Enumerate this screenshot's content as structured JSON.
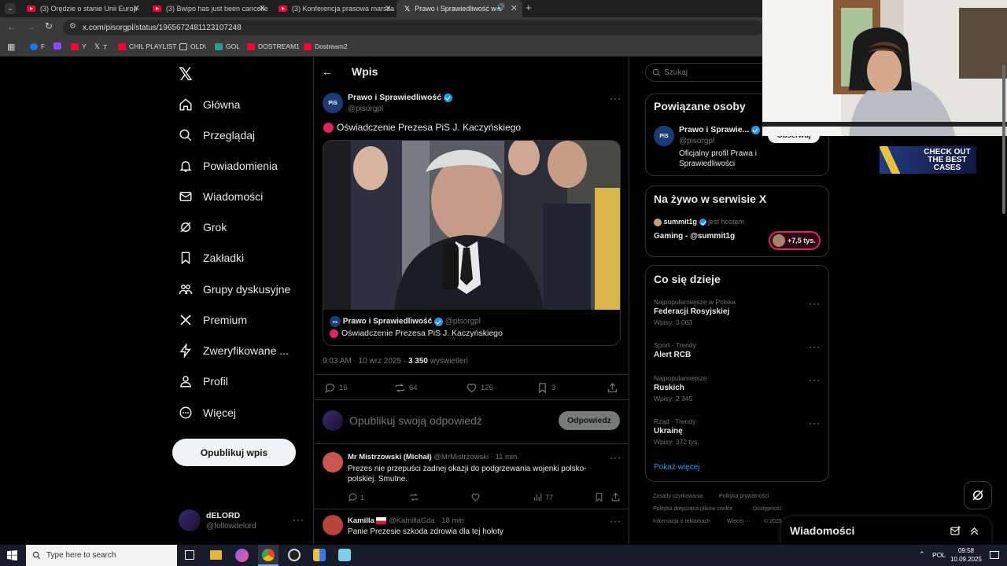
{
  "browser": {
    "tabs": [
      {
        "title": "(3) Orędzie o stanie Unii Europ",
        "active": false
      },
      {
        "title": "(3) Bwipo has just been cancelle",
        "active": false
      },
      {
        "title": "(3) Konferencja prasowa marsza",
        "active": false
      },
      {
        "title": "Prawo i Sprawiedliwość w s",
        "active": true
      }
    ],
    "new_tab": "+",
    "url": "x.com/pisorgpl/status/1965672481123107248",
    "bookmarks": [
      "F",
      "Y",
      "T",
      "CHIL PLAYLIST",
      "OLD\\",
      "GOL",
      "DOSTREAM1",
      "Dostream2"
    ]
  },
  "nav": {
    "items": [
      "Główna",
      "Przeglądaj",
      "Powiadomienia",
      "Wiadomości",
      "Grok",
      "Zakładki",
      "Grupy dyskusyjne",
      "Premium",
      "Zweryfikowane ...",
      "Profil",
      "Więcej"
    ],
    "post_button": "Opublikuj wpis",
    "account": {
      "name": "dELORD",
      "handle": "@followdelord"
    }
  },
  "post": {
    "header": "Wpis",
    "author": "Prawo i Sprawiedliwość",
    "handle": "@pisorgpl",
    "avatar_text": "PiS",
    "text": "Oświadczenie Prezesa PiS J. Kaczyńskiego",
    "quote": {
      "author": "Prawo i Sprawiedliwość",
      "handle": "@pisorgpl",
      "text": "Oświadczenie Prezesa PiS J. Kaczyńskiego"
    },
    "time": "9:03 AM · 10 wrz 2025 · ",
    "views": "3 350",
    "views_label": " wyświetleń",
    "stats": {
      "replies": "16",
      "reposts": "64",
      "likes": "126",
      "bookmarks": "3"
    },
    "reply_placeholder": "Opublikuj swoją odpowiedź",
    "reply_button": "Odpowiedz"
  },
  "replies": [
    {
      "name": "Mr Mistrzowski (Michał)",
      "handle": "@MrMistrzowski · 11 min",
      "text": "Prezes nie przepuści żadnej okazji do podgrzewania wojenki polsko-polskiej. Smutne.",
      "replies": "1",
      "views": "77"
    },
    {
      "name": "Kamilla",
      "handle": "@KamillaGda · 18 min",
      "text": "Panie Prezesie szkoda zdrowia dla tej hołoty"
    }
  ],
  "right": {
    "search_placeholder": "Szukaj",
    "related_title": "Powiązane osoby",
    "related": {
      "name": "Prawo i Sprawie...",
      "handle": "@pisorgpl",
      "bio": "Oficjalny profil Prawa i Sprawiedliwości",
      "follow": "Obserwuj"
    },
    "live_title": "Na żywo w serwisie X",
    "live": {
      "host": "summit1g",
      "host_label": "jest hostem",
      "title": "Gaming - @summit1g",
      "count": "+7,5 tys."
    },
    "trends_title": "Co się dzieje",
    "trends": [
      {
        "category": "Najpopularniejsze w Polska",
        "name": "Federacji Rosyjskiej",
        "count": "Wpisy: 3 063"
      },
      {
        "category": "Sport · Trendy",
        "name": "Alert RCB",
        "count": ""
      },
      {
        "category": "Najpopularniejsze",
        "name": "Ruskich",
        "count": "Wpisy: 2 345"
      },
      {
        "category": "Rząd · Trendy",
        "name": "Ukrainę",
        "count": "Wpisy: 372 tys."
      }
    ],
    "show_more": "Pokaż więcej",
    "footer": [
      "Zasady użytkowania",
      "Polityka prywatności",
      "Polityka dotycząca plików cookie",
      "Dostępność",
      "Informacja o reklamach",
      "Więcej ···",
      "© 2025"
    ],
    "messages_title": "Wiadomości"
  },
  "overlay": {
    "promo": "CHECK OUT THE BEST CASES"
  },
  "taskbar": {
    "search": "Type here to search",
    "lang": "POL",
    "time": "09:58",
    "date": "10.09.2025"
  },
  "colors": {
    "accent": "#1d9bf0",
    "background": "#000000",
    "border": "#2f3336",
    "muted": "#71767b"
  }
}
